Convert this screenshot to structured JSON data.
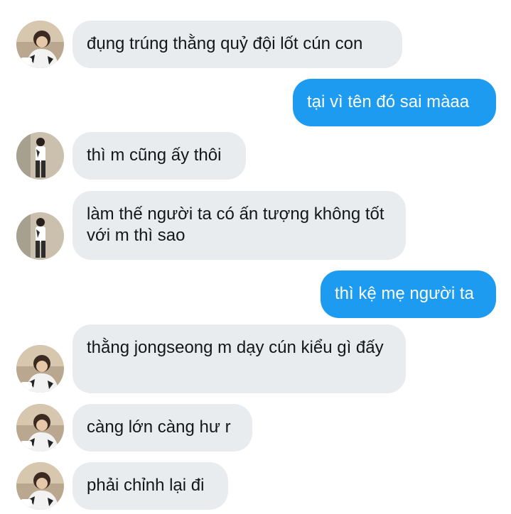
{
  "messages": [
    {
      "direction": "in",
      "avatar": "avatar-a",
      "text": "đụng trúng thằng quỷ đội lốt cún con"
    },
    {
      "direction": "out",
      "text": "tại vì tên đó sai màaa"
    },
    {
      "direction": "in",
      "avatar": "avatar-b",
      "text": "thì m cũng ấy thôi"
    },
    {
      "direction": "in",
      "avatar": "avatar-b",
      "text": "làm thế người ta có ấn tượng không tốt với m thì sao"
    },
    {
      "direction": "out",
      "text": "thì kệ mẹ người ta"
    },
    {
      "direction": "in",
      "avatar": "avatar-a",
      "text": "thằng jongseong m dạy cún kiểu gì đấy"
    },
    {
      "direction": "in",
      "avatar": "avatar-a",
      "text": "càng lớn càng hư r"
    },
    {
      "direction": "in",
      "avatar": "avatar-a",
      "text": "phải chỉnh lại đi"
    }
  ],
  "colors": {
    "incoming_bubble": "#e9ecef",
    "outgoing_bubble": "#1d9bf0",
    "incoming_text": "#14171a",
    "outgoing_text": "#ffffff"
  }
}
